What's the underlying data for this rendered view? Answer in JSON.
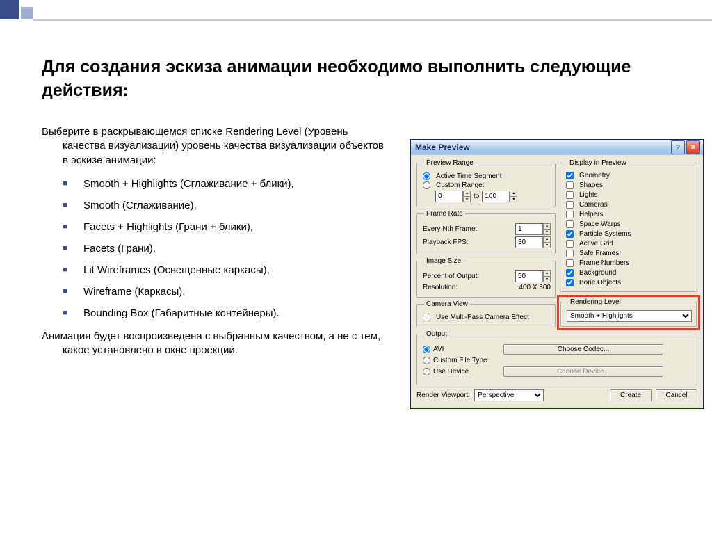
{
  "slide": {
    "title": "Для создания эскиза анимации необходимо выполнить следующие действия:",
    "intro": "Выберите в раскрывающемся списке Rendering Level (Уровень качества визуализации) уровень качества визуализации объектов в эскизе анимации:",
    "items": [
      "Smooth + Highlights (Сглаживание + блики),",
      "Smooth (Сглаживание),",
      " Facets + Highlights (Грани + блики),",
      "Facets (Грани),",
      "Lit Wireframes (Освещенные каркасы),",
      "Wireframe (Каркасы),",
      "Bounding Box (Габаритные контейнеры)."
    ],
    "outro": "Анимация будет воспроизведена с выбранным качеством, а не с тем, какое установлено в окне проекции."
  },
  "dialog": {
    "title": "Make Preview",
    "previewRange": {
      "legend": "Preview Range",
      "activeSegment": "Active Time Segment",
      "customRange": "Custom Range:",
      "from": "0",
      "toLabel": "to",
      "to": "100"
    },
    "frameRate": {
      "legend": "Frame Rate",
      "everyNth": "Every Nth Frame:",
      "everyNthVal": "1",
      "playback": "Playback FPS:",
      "playbackVal": "30"
    },
    "imageSize": {
      "legend": "Image Size",
      "percent": "Percent of Output:",
      "percentVal": "50",
      "resolution": "Resolution:",
      "resolutionVal": "400  X  300"
    },
    "cameraView": {
      "legend": "Camera View",
      "multipass": "Use Multi-Pass Camera Effect"
    },
    "display": {
      "legend": "Display in Preview",
      "items": [
        {
          "label": "Geometry",
          "checked": true
        },
        {
          "label": "Shapes",
          "checked": false
        },
        {
          "label": "Lights",
          "checked": false
        },
        {
          "label": "Cameras",
          "checked": false
        },
        {
          "label": "Helpers",
          "checked": false
        },
        {
          "label": "Space Warps",
          "checked": false
        },
        {
          "label": "Particle Systems",
          "checked": true
        },
        {
          "label": "Active Grid",
          "checked": false
        },
        {
          "label": "Safe Frames",
          "checked": false
        },
        {
          "label": "Frame Numbers",
          "checked": false
        },
        {
          "label": "Background",
          "checked": true
        },
        {
          "label": "Bone Objects",
          "checked": true
        }
      ]
    },
    "renderingLevel": {
      "legend": "Rendering Level",
      "value": "Smooth + Highlights"
    },
    "output": {
      "legend": "Output",
      "avi": "AVI",
      "codec": "Choose Codec...",
      "customFile": "Custom File Type",
      "useDevice": "Use Device",
      "chooseDevice": "Choose Device..."
    },
    "footer": {
      "viewport": "Render Viewport:",
      "viewportVal": "Perspective",
      "create": "Create",
      "cancel": "Cancel"
    }
  }
}
